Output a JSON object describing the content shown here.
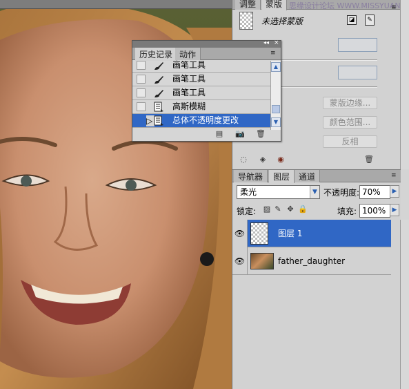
{
  "watermark": "思缘设计论坛 WWW.MISSYUAN.COM",
  "masks_panel": {
    "tabs": [
      "调整",
      "蒙版"
    ],
    "status": "未选择蒙版",
    "buttons": [
      "蒙版边缘...",
      "颜色范围...",
      "反相"
    ]
  },
  "history_panel": {
    "tabs": [
      "历史记录",
      "动作"
    ],
    "items": [
      {
        "label": "画笔工具",
        "icon": "brush-icon"
      },
      {
        "label": "画笔工具",
        "icon": "brush-icon"
      },
      {
        "label": "画笔工具",
        "icon": "brush-icon"
      },
      {
        "label": "高斯模糊",
        "icon": "filter-document-icon"
      },
      {
        "label": "总体不透明度更改",
        "icon": "filter-document-icon"
      }
    ],
    "active_index": 4
  },
  "layers_panel": {
    "tabs": [
      "导航器",
      "图层",
      "通道"
    ],
    "blend_mode": "柔光",
    "opacity_label": "不透明度:",
    "opacity_value": "70%",
    "lock_label": "锁定:",
    "fill_label": "填充:",
    "fill_value": "100%",
    "layers": [
      {
        "name": "图层 1",
        "selected": true,
        "visible": true
      },
      {
        "name": "father_daughter",
        "selected": false,
        "visible": true
      }
    ]
  },
  "colors": {
    "selection": "#3067c5",
    "panel_bg": "#d2d2d2",
    "tab_bg": "#a9a9a9"
  }
}
